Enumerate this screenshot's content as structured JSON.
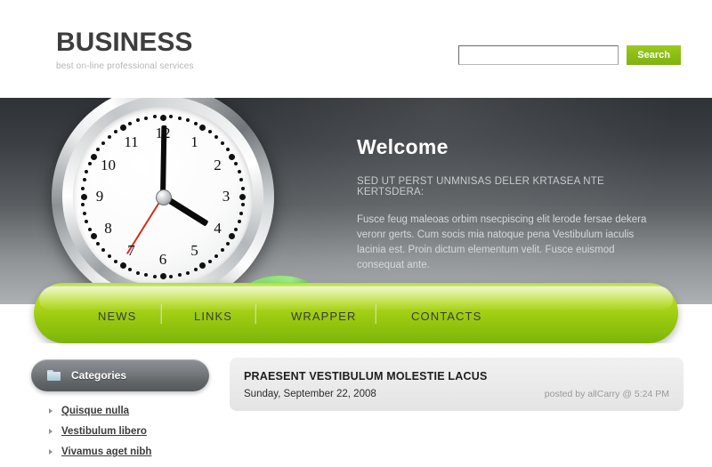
{
  "header": {
    "logo_title": "BUSINESS",
    "logo_tagline": "best on-line professional services",
    "search": {
      "value": "",
      "placeholder": "",
      "button_label": "Search"
    }
  },
  "banner": {
    "title": "Welcome",
    "subtitle": "SED UT PERST UNMNISAS DELER KRTASEA NTE KERTSDERA:",
    "body": "Fusce feug maleoas orbim nsecpiscing elit lerode fersae dekera veronr gerts. Cum socis mia natoque pena Vestibulum iaculis lacinia est. Proin dictum elementum velit. Fusce euismod consequat ante.",
    "graphic": {
      "clock_label": "chrome-alarm-clock",
      "arrow_label": "green-3d-arrow",
      "numerals": [
        "1",
        "2",
        "3",
        "4",
        "5",
        "6",
        "7",
        "8",
        "9",
        "10",
        "11",
        "12"
      ]
    }
  },
  "nav": {
    "items": [
      {
        "label": "NEWS"
      },
      {
        "label": "LINKS"
      },
      {
        "label": "WRAPPER"
      },
      {
        "label": "CONTACTS"
      }
    ]
  },
  "sidebar": {
    "header_label": "Categories",
    "header_icon": "folder-icon",
    "items": [
      {
        "label": "Quisque nulla"
      },
      {
        "label": "Vestibulum libero"
      },
      {
        "label": "Vivamus aget nibh"
      }
    ]
  },
  "content": {
    "post": {
      "title": "PRAESENT VESTIBULUM MOLESTIE LACUS",
      "date": "Sunday, September 22, 2008",
      "author_line": "posted by allCarry @ 5:24 PM"
    }
  },
  "colors": {
    "accent_green": "#9ccb11",
    "nav_green_light": "#cfe96a",
    "nav_green_dark": "#7cb40a",
    "button_green": "#8cbd16",
    "banner_dark": "#2f3236",
    "banner_light": "#aeb1b3",
    "sidebar_grey": "#636669",
    "text_dark": "#3d3d3d",
    "text_muted": "#b4b4b4"
  }
}
